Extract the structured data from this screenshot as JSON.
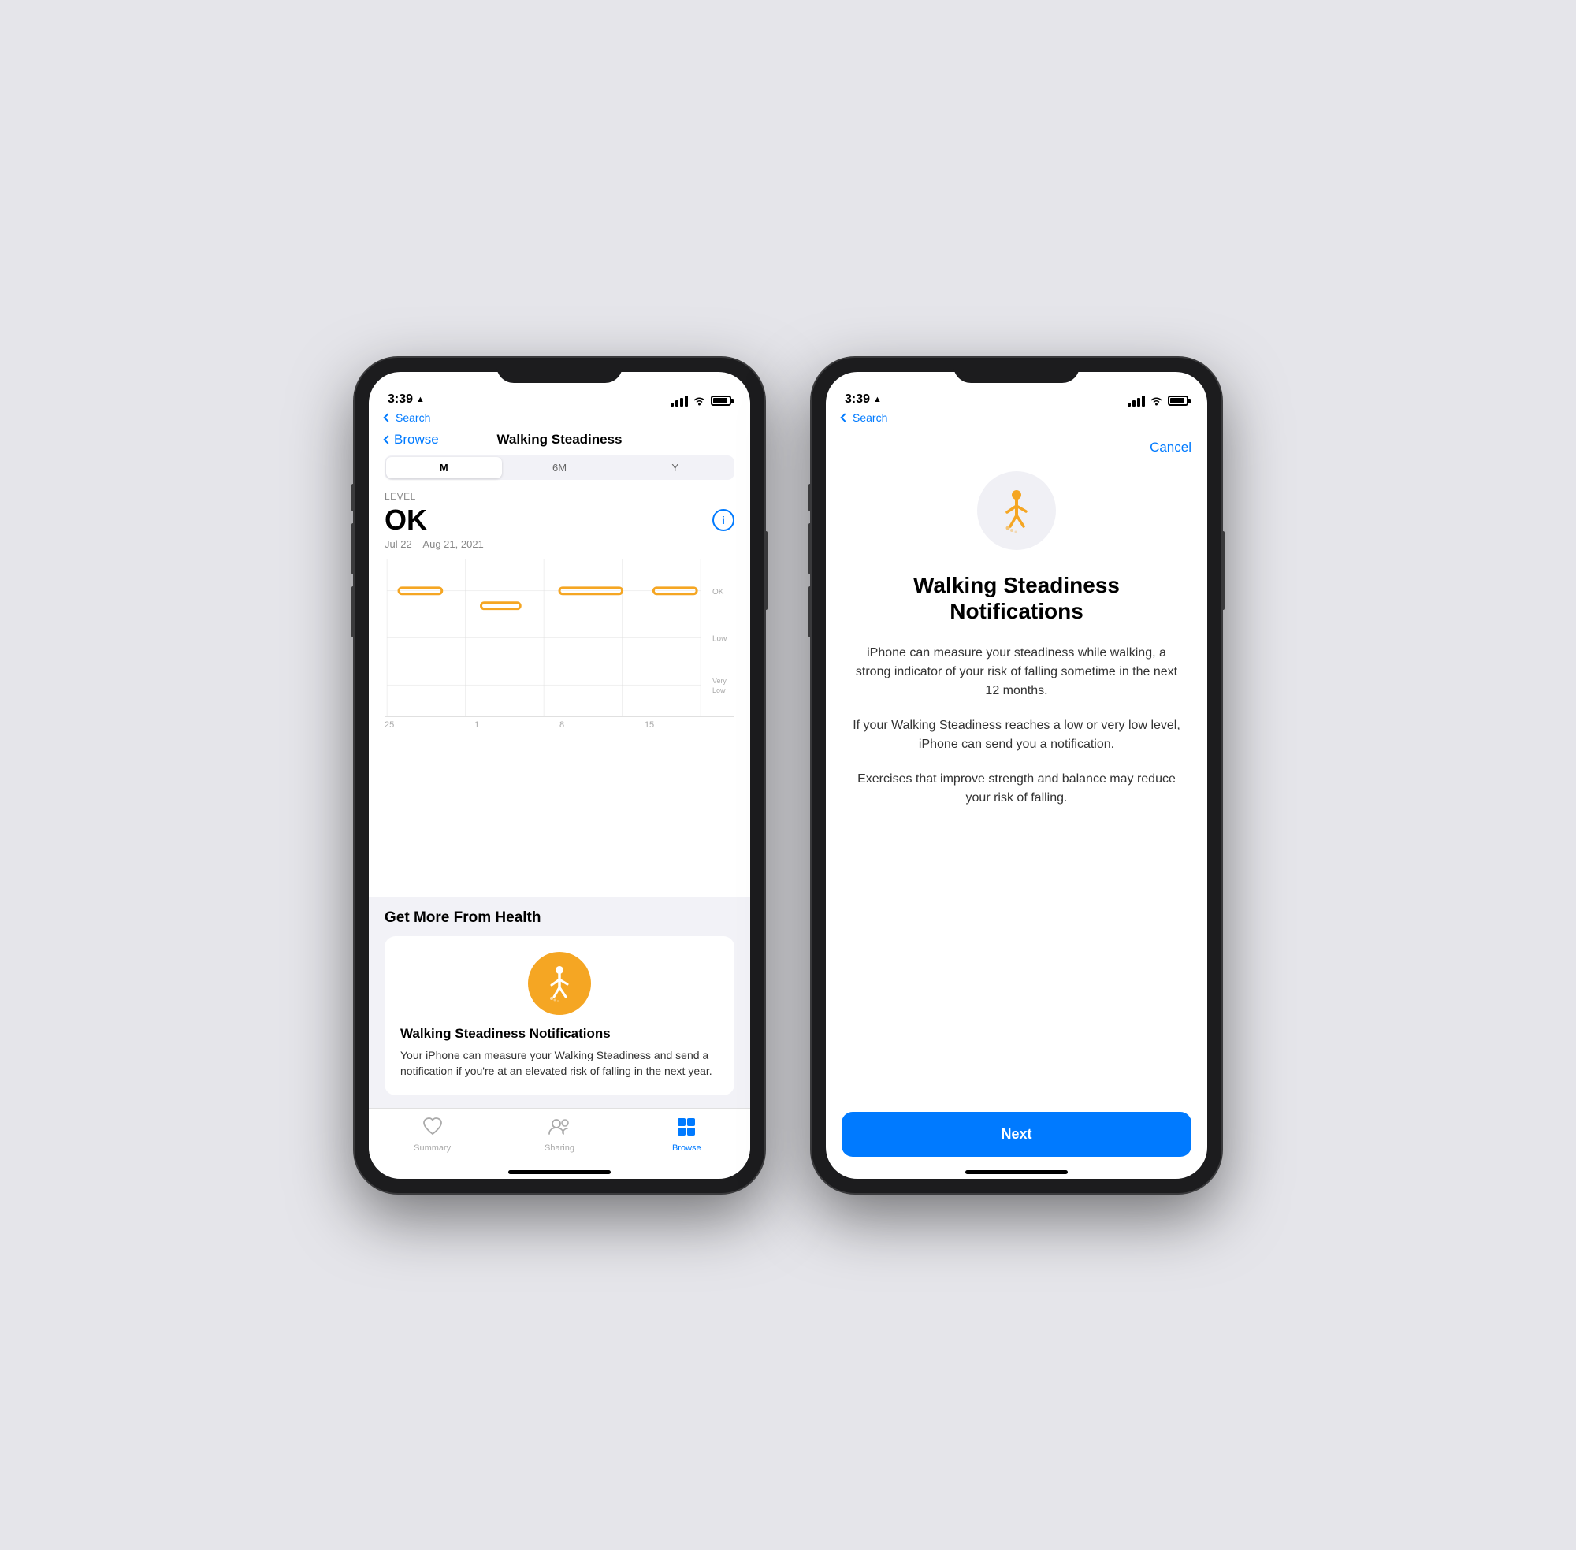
{
  "phone1": {
    "statusBar": {
      "time": "3:39",
      "locationIcon": "▲"
    },
    "navigation": {
      "backLabel": "Browse",
      "title": "Walking Steadiness"
    },
    "searchBack": "◄ Search",
    "periodSelector": {
      "options": [
        "M",
        "6M",
        "Y"
      ],
      "active": 0
    },
    "chart": {
      "levelLabel": "LEVEL",
      "levelValue": "OK",
      "dateRange": "Jul 22 – Aug 21, 2021",
      "yLabels": [
        "OK",
        "Low",
        "Very\nLow"
      ],
      "xLabels": [
        "25",
        "1",
        "8",
        "15"
      ],
      "infoBtn": "ⓘ"
    },
    "getMoreSection": {
      "title": "Get More From Health",
      "card": {
        "title": "Walking Steadiness Notifications",
        "description": "Your iPhone can measure your Walking Steadiness and send a notification if you're at an elevated risk of falling in the next year."
      }
    },
    "tabBar": {
      "tabs": [
        {
          "label": "Summary",
          "icon": "♥"
        },
        {
          "label": "Sharing",
          "icon": "👥"
        },
        {
          "label": "Browse",
          "icon": "⊞"
        }
      ],
      "activeIndex": 2
    }
  },
  "phone2": {
    "statusBar": {
      "time": "3:39",
      "locationIcon": "▲"
    },
    "searchBack": "◄ Search",
    "cancelLabel": "Cancel",
    "modal": {
      "title": "Walking Steadiness Notifications",
      "paragraphs": [
        "iPhone can measure your steadiness while walking, a strong indicator of your risk of falling sometime in the next 12 months.",
        "If your Walking Steadiness reaches a low or very low level, iPhone can send you a notification.",
        "Exercises that improve strength and balance may reduce your risk of falling."
      ],
      "nextButton": "Next"
    }
  }
}
